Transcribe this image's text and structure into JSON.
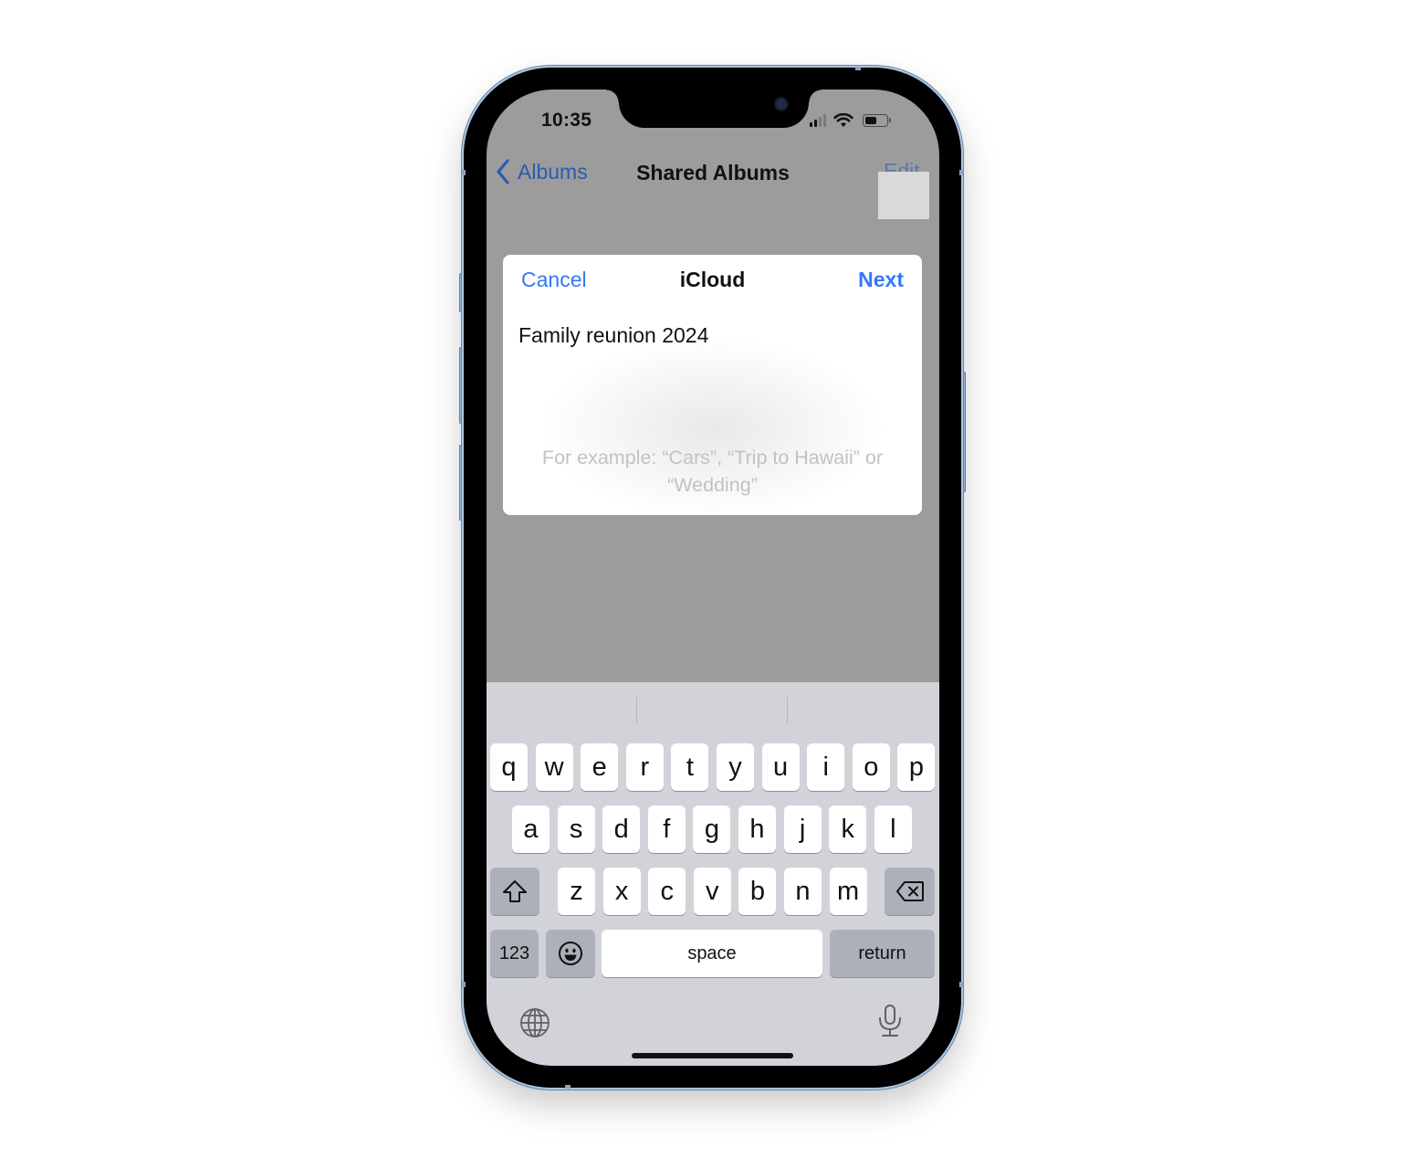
{
  "status_bar": {
    "time": "10:35",
    "signal_bars": 2,
    "signal_total": 4,
    "wifi": "wifi-icon",
    "battery_level": 0.5
  },
  "nav": {
    "back_label": "Albums",
    "title": "Shared Albums",
    "edit_label": "Edit"
  },
  "dialog": {
    "cancel_label": "Cancel",
    "title": "iCloud",
    "next_label": "Next",
    "input_value": "Family reunion 2024",
    "hint": "For example: “Cars”, “Trip to Hawaii” or “Wedding”"
  },
  "keyboard": {
    "row1": [
      "q",
      "w",
      "e",
      "r",
      "t",
      "y",
      "u",
      "i",
      "o",
      "p"
    ],
    "row2": [
      "a",
      "s",
      "d",
      "f",
      "g",
      "h",
      "j",
      "k",
      "l"
    ],
    "row3": [
      "z",
      "x",
      "c",
      "v",
      "b",
      "n",
      "m"
    ],
    "shift": "shift-icon",
    "delete": "delete-icon",
    "numbers_label": "123",
    "emoji": "emoji-icon",
    "space_label": "space",
    "return_label": "return",
    "globe": "globe-icon",
    "mic": "microphone-icon"
  },
  "colors": {
    "accent": "#3478f6",
    "nav_accent": "#2b5bb0",
    "keyboard_bg": "#d1d3d9",
    "function_key": "#acb0b9",
    "frame": "#a9c6e4"
  }
}
